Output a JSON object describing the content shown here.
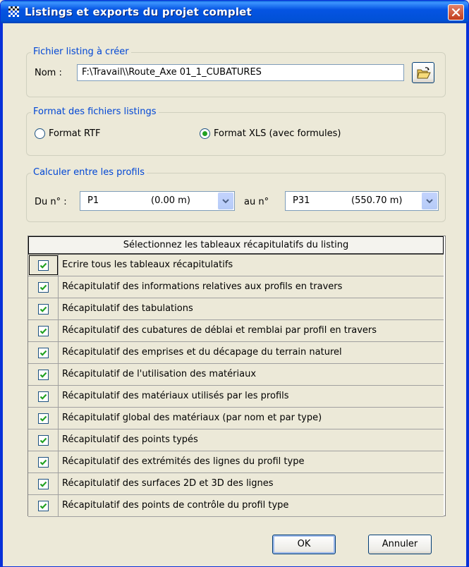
{
  "window": {
    "title": "Listings et exports du projet complet"
  },
  "file_group": {
    "legend": "Fichier listing à créer",
    "name_label": "Nom :",
    "path_value": "F:\\Travail\\\\Route_Axe 01_1_CUBATURES"
  },
  "format_group": {
    "legend": "Format des fichiers listings",
    "options": [
      {
        "label": "Format RTF",
        "selected": false
      },
      {
        "label": "Format XLS (avec formules)",
        "selected": true
      }
    ]
  },
  "range_group": {
    "legend": "Calculer entre les profils",
    "from_label": "Du n° :",
    "from_code": "P1",
    "from_dist": "(0.00 m)",
    "to_label": "au n°",
    "to_code": "P31",
    "to_dist": "(550.70 m)"
  },
  "table": {
    "header": "Sélectionnez les tableaux récapitulatifs du listing",
    "rows": [
      {
        "label": "Ecrire tous les tableaux récapitulatifs",
        "checked": true
      },
      {
        "label": "Récapitulatif des informations relatives aux profils en travers",
        "checked": true
      },
      {
        "label": "Récapitulatif des tabulations",
        "checked": true
      },
      {
        "label": "Récapitulatif des cubatures de déblai et remblai par profil en travers",
        "checked": true
      },
      {
        "label": "Récapitulatif des emprises et du décapage du terrain naturel",
        "checked": true
      },
      {
        "label": "Récapitulatif de l'utilisation des matériaux",
        "checked": true
      },
      {
        "label": "Récapitulatif des matériaux utilisés par les profils",
        "checked": true
      },
      {
        "label": "Récapitulatif global des matériaux (par nom et par type)",
        "checked": true
      },
      {
        "label": "Récapitulatif des points typés",
        "checked": true
      },
      {
        "label": "Récapitulatif des extrémités des lignes du profil type",
        "checked": true
      },
      {
        "label": "Récapitulatif des surfaces 2D et 3D des lignes",
        "checked": true
      },
      {
        "label": "Récapitulatif des points de contrôle du profil type",
        "checked": true
      }
    ]
  },
  "buttons": {
    "ok": "OK",
    "cancel": "Annuler"
  },
  "colors": {
    "title_bar": "#0554E3",
    "legend_text": "#0046D5",
    "check_mark": "#21A121",
    "close_button": "#C23C1C"
  }
}
